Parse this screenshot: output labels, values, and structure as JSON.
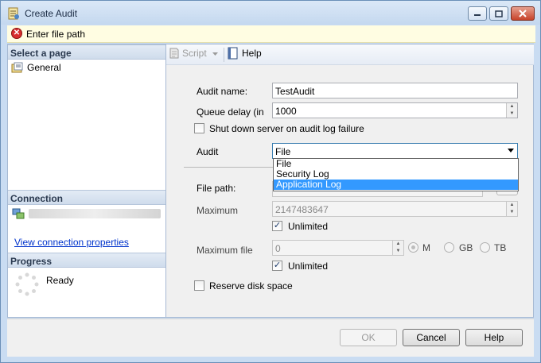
{
  "window": {
    "title": "Create Audit",
    "message": "Enter file path",
    "icons": {
      "app": "audit-wizard-icon",
      "error": "error-icon"
    }
  },
  "left": {
    "select_page_header": "Select a page",
    "pages": [
      {
        "label": "General",
        "icon": "page-icon"
      }
    ],
    "connection_header": "Connection",
    "connection_server": "",
    "view_connection_link": "View connection properties",
    "progress_header": "Progress",
    "progress_status": "Ready"
  },
  "toolbar": {
    "script_label": "Script",
    "help_label": "Help"
  },
  "form": {
    "audit_name_label": "Audit name:",
    "audit_name_value": "TestAudit",
    "queue_delay_label": "Queue delay (in",
    "queue_delay_value": "1000",
    "shutdown_label": "Shut down server on audit log failure",
    "audit_label": "Audit",
    "audit_selected": "File",
    "audit_options": [
      "File",
      "Security Log",
      "Application Log"
    ],
    "file_path_label": "File path:",
    "maximum_label": "Maximum",
    "maximum_value": "2147483647",
    "unlimited_label_1": "Unlimited",
    "maximum_file_label": "Maximum file",
    "maximum_file_value": "0",
    "unit_m": "M",
    "unit_gb": "GB",
    "unit_tb": "TB",
    "unlimited_label_2": "Unlimited",
    "reserve_label": "Reserve disk space"
  },
  "buttons": {
    "ok": "OK",
    "cancel": "Cancel",
    "help": "Help"
  },
  "colors": {
    "accent": "#3399ff",
    "link": "#0033cc",
    "error": "#d72e2e"
  }
}
